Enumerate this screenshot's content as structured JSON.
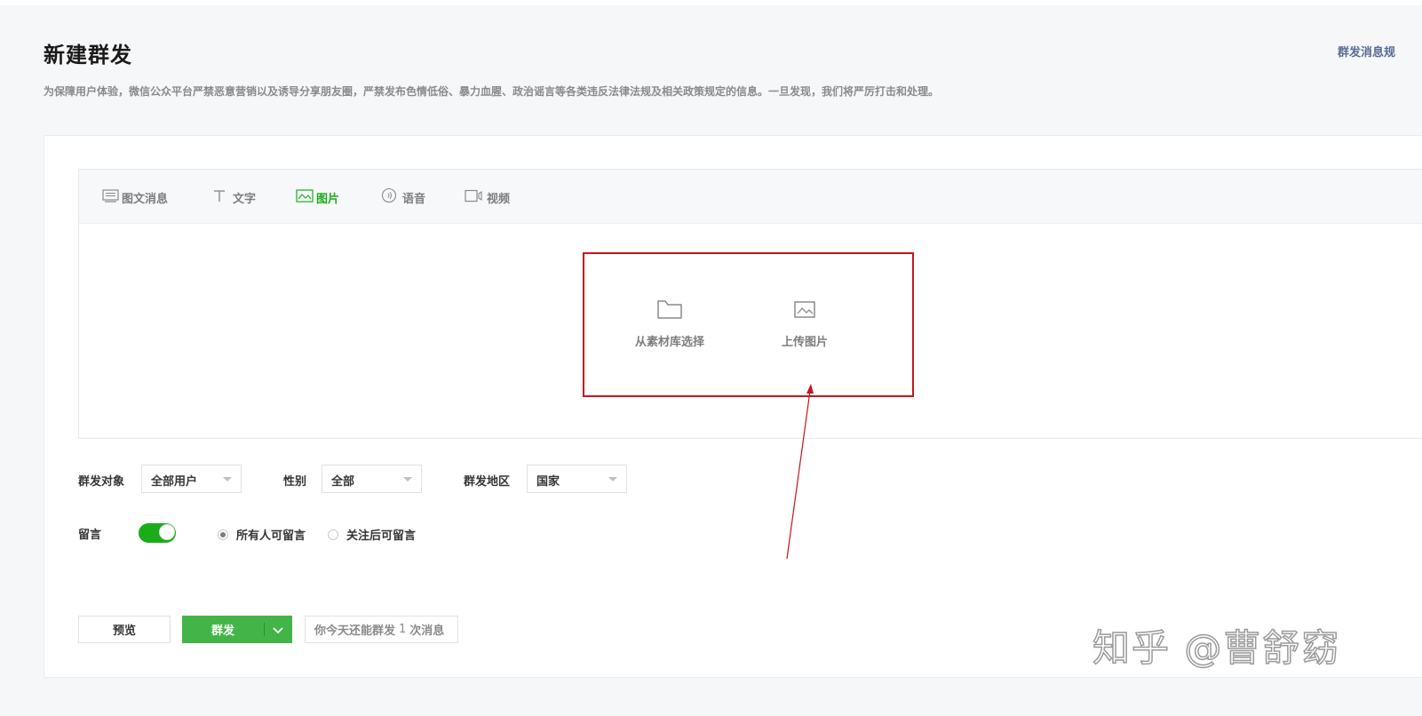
{
  "page": {
    "title": "新建群发",
    "top_link": "群发消息规",
    "notice": "为保障用户体验，微信公众平台严禁恶意营销以及诱导分享朋友圈，严禁发布色情低俗、暴力血腥、政治谣言等各类违反法律法规及相关政策规定的信息。一旦发现，我们将严厉打击和处理。"
  },
  "tabs": [
    {
      "label": "图文消息",
      "icon": "news-icon",
      "active": false
    },
    {
      "label": "文字",
      "icon": "text-icon",
      "active": false
    },
    {
      "label": "图片",
      "icon": "image-icon",
      "active": true
    },
    {
      "label": "语音",
      "icon": "voice-icon",
      "active": false
    },
    {
      "label": "视频",
      "icon": "video-icon",
      "active": false
    }
  ],
  "image_options": {
    "library_label": "从素材库选择",
    "upload_label": "上传图片"
  },
  "filters": {
    "target_label": "群发对象",
    "target_value": "全部用户",
    "gender_label": "性别",
    "gender_value": "全部",
    "region_label": "群发地区",
    "region_value": "国家"
  },
  "comments": {
    "label": "留言",
    "enabled": true,
    "option_all": "所有人可留言",
    "option_followers": "关注后可留言",
    "selected": "所有人可留言"
  },
  "actions": {
    "preview_label": "预览",
    "send_label": "群发",
    "quota_prefix": "你今天还能群发",
    "quota_count": "1",
    "quota_suffix": "次消息"
  },
  "watermark": "知乎 @曹舒窈",
  "colors": {
    "accent_green": "#1aad19",
    "annotation_red": "#c4161c",
    "link_blue": "#576b95"
  }
}
